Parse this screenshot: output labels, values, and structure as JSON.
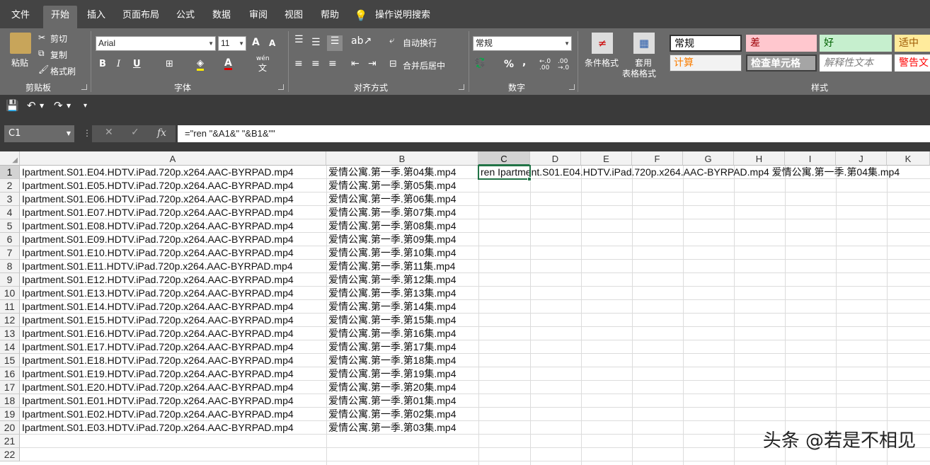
{
  "menu": {
    "tabs": [
      "文件",
      "开始",
      "插入",
      "页面布局",
      "公式",
      "数据",
      "审阅",
      "视图",
      "帮助"
    ],
    "search": "操作说明搜索",
    "active": "开始"
  },
  "ribbon": {
    "clipboard": {
      "paste": "粘贴",
      "cut": "剪切",
      "copy": "复制",
      "format_painter": "格式刷",
      "label": "剪贴板"
    },
    "font": {
      "name": "Arial",
      "size": "11",
      "bold": "B",
      "italic": "I",
      "underline": "U",
      "label": "字体",
      "grow": "A",
      "shrink": "A",
      "phonetic_top": "wén",
      "phonetic_bottom": "文"
    },
    "alignment": {
      "wrap": "自动换行",
      "merge": "合并后居中",
      "label": "对齐方式"
    },
    "number": {
      "format": "常规",
      "percent": "%",
      "comma": ",",
      "inc_decimal": "←.0\n.00",
      "dec_decimal": ".00\n→.0",
      "label": "数字"
    },
    "styles_group": {
      "conditional": "条件格式",
      "table_top": "套用",
      "table_bottom": "表格格式",
      "label": "样式"
    },
    "styles": {
      "normal": "常规",
      "bad": "差",
      "good": "好",
      "neutral": "适中",
      "calc": "计算",
      "check": "检查单元格",
      "explanatory": "解释性文本",
      "warning": "警告文"
    }
  },
  "formula_bar": {
    "name_box": "C1",
    "formula": "=\"ren \"&A1&\" \"&B1&\"\"",
    "fx": "fx"
  },
  "columns": [
    "A",
    "B",
    "C",
    "D",
    "E",
    "F",
    "G",
    "H",
    "I",
    "J",
    "K"
  ],
  "rows": [
    "1",
    "2",
    "3",
    "4",
    "5",
    "6",
    "7",
    "8",
    "9",
    "10",
    "11",
    "12",
    "13",
    "14",
    "15",
    "16",
    "17",
    "18",
    "19",
    "20",
    "21",
    "22"
  ],
  "cells": {
    "A": [
      "Ipartment.S01.E04.HDTV.iPad.720p.x264.AAC-BYRPAD.mp4",
      "Ipartment.S01.E05.HDTV.iPad.720p.x264.AAC-BYRPAD.mp4",
      "Ipartment.S01.E06.HDTV.iPad.720p.x264.AAC-BYRPAD.mp4",
      "Ipartment.S01.E07.HDTV.iPad.720p.x264.AAC-BYRPAD.mp4",
      "Ipartment.S01.E08.HDTV.iPad.720p.x264.AAC-BYRPAD.mp4",
      "Ipartment.S01.E09.HDTV.iPad.720p.x264.AAC-BYRPAD.mp4",
      "Ipartment.S01.E10.HDTV.iPad.720p.x264.AAC-BYRPAD.mp4",
      "Ipartment.S01.E11.HDTV.iPad.720p.x264.AAC-BYRPAD.mp4",
      "Ipartment.S01.E12.HDTV.iPad.720p.x264.AAC-BYRPAD.mp4",
      "Ipartment.S01.E13.HDTV.iPad.720p.x264.AAC-BYRPAD.mp4",
      "Ipartment.S01.E14.HDTV.iPad.720p.x264.AAC-BYRPAD.mp4",
      "Ipartment.S01.E15.HDTV.iPad.720p.x264.AAC-BYRPAD.mp4",
      "Ipartment.S01.E16.HDTV.iPad.720p.x264.AAC-BYRPAD.mp4",
      "Ipartment.S01.E17.HDTV.iPad.720p.x264.AAC-BYRPAD.mp4",
      "Ipartment.S01.E18.HDTV.iPad.720p.x264.AAC-BYRPAD.mp4",
      "Ipartment.S01.E19.HDTV.iPad.720p.x264.AAC-BYRPAD.mp4",
      "Ipartment.S01.E20.HDTV.iPad.720p.x264.AAC-BYRPAD.mp4",
      "Ipartment.S01.E01.HDTV.iPad.720p.x264.AAC-BYRPAD.mp4",
      "Ipartment.S01.E02.HDTV.iPad.720p.x264.AAC-BYRPAD.mp4",
      "Ipartment.S01.E03.HDTV.iPad.720p.x264.AAC-BYRPAD.mp4"
    ],
    "B": [
      "爱情公寓.第一季.第04集.mp4",
      "爱情公寓.第一季.第05集.mp4",
      "爱情公寓.第一季.第06集.mp4",
      "爱情公寓.第一季.第07集.mp4",
      "爱情公寓.第一季.第08集.mp4",
      "爱情公寓.第一季.第09集.mp4",
      "爱情公寓.第一季.第10集.mp4",
      "爱情公寓.第一季.第11集.mp4",
      "爱情公寓.第一季.第12集.mp4",
      "爱情公寓.第一季.第13集.mp4",
      "爱情公寓.第一季.第14集.mp4",
      "爱情公寓.第一季.第15集.mp4",
      "爱情公寓.第一季.第16集.mp4",
      "爱情公寓.第一季.第17集.mp4",
      "爱情公寓.第一季.第18集.mp4",
      "爱情公寓.第一季.第19集.mp4",
      "爱情公寓.第一季.第20集.mp4",
      "爱情公寓.第一季.第01集.mp4",
      "爱情公寓.第一季.第02集.mp4",
      "爱情公寓.第一季.第03集.mp4"
    ],
    "C1": "ren Ipartment.S01.E04.HDTV.iPad.720p.x264.AAC-BYRPAD.mp4 爱情公寓.第一季.第04集.mp4"
  },
  "watermark": "头条 @若是不相见",
  "colors": {
    "accent": "#217346",
    "ribbon": "#6a6a6a",
    "menubar": "#444444"
  }
}
